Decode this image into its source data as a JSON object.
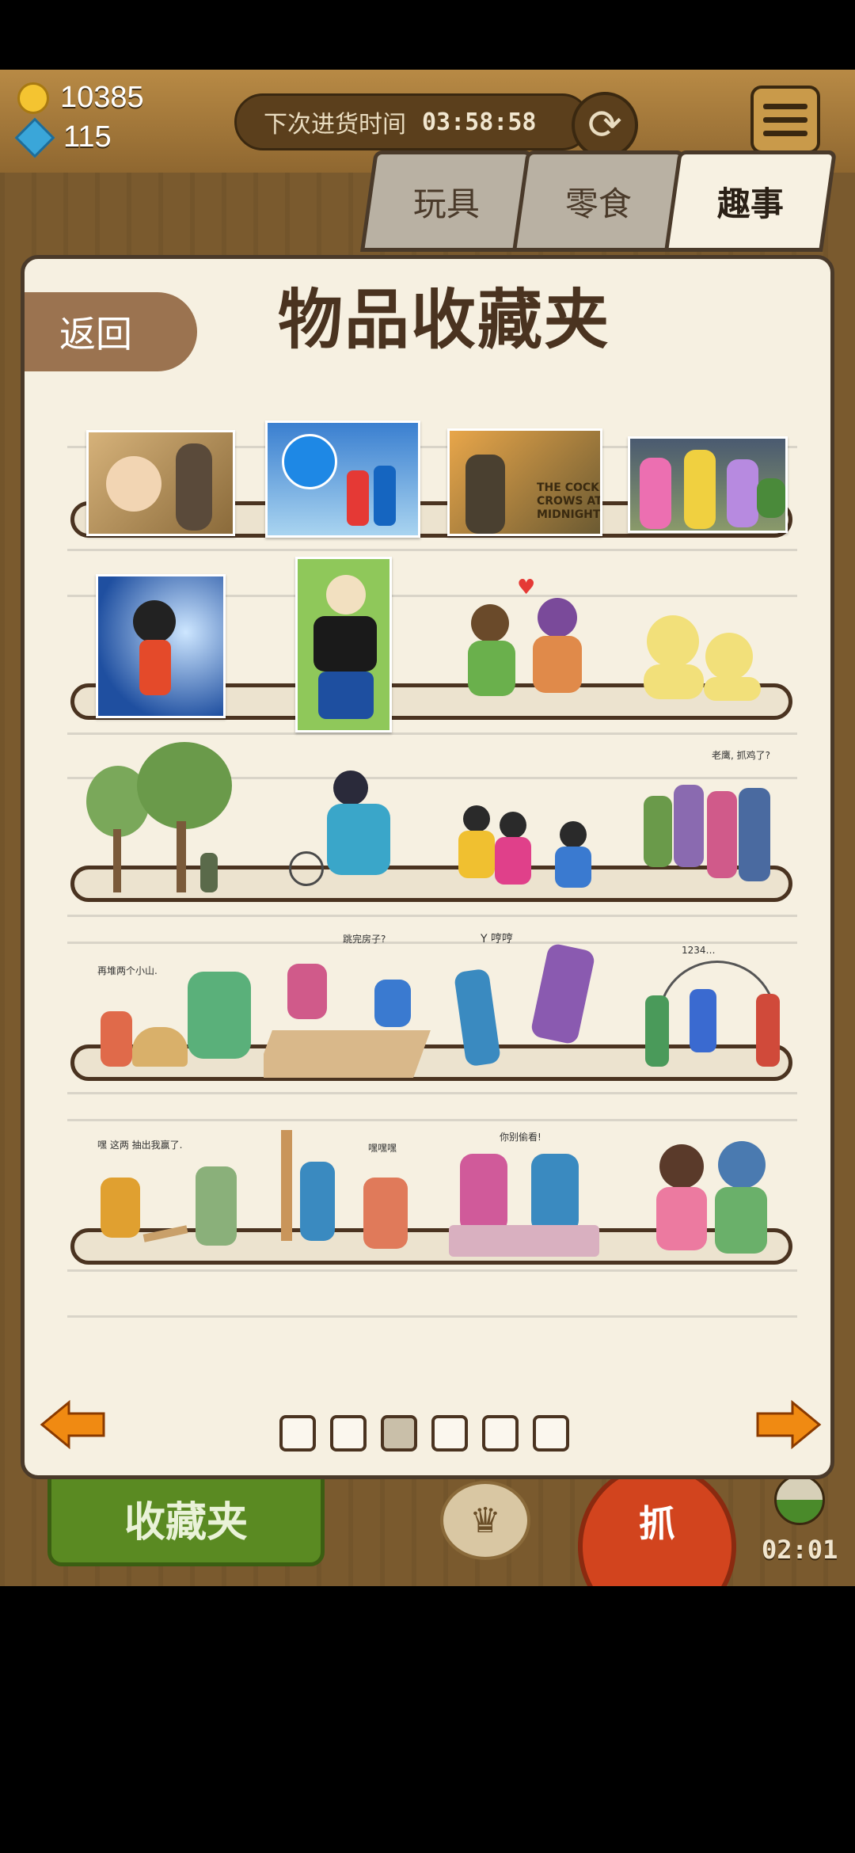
{
  "status": {
    "coins": "10385",
    "gems": "115"
  },
  "restock": {
    "label": "下次进货时间",
    "timer": "03:58:58"
  },
  "tabs": [
    {
      "label": "玩具"
    },
    {
      "label": "零食"
    },
    {
      "label": "趣事"
    }
  ],
  "active_tab": "趣事",
  "panel": {
    "title": "物品收藏夹",
    "back_label": "返回"
  },
  "items": {
    "row1": [
      "big-head-son-card",
      "doraemon-card",
      "cock-crows-card",
      "black-cat-mice-card"
    ],
    "row1_texts": {
      "cock_crows": "THE COCK CROWS AT MIDNIGHT"
    },
    "row2": [
      "astro-boy-card",
      "popeye-card",
      "kids-sharing-figure",
      "twin-sprouts-figure"
    ],
    "row3": [
      "kids-in-forest-figure",
      "rolling-hoop-figure",
      "kids-playing-figure",
      "kids-line-figure"
    ],
    "row3_texts": {
      "kids_line": "老鹰, 抓鸡了?"
    },
    "row4": [
      "sand-play-figure",
      "hopscotch-figure",
      "kick-play-figure",
      "jump-rope-figure"
    ],
    "row4_texts": {
      "sand_play": "再堆两个小山.",
      "hopscotch": "跳完房子?",
      "kick_play": "Y 哼哼",
      "jump_rope": "1234…"
    },
    "row5": [
      "sticks-game-figure",
      "hide-seek-figure",
      "homework-figure",
      "happy-pair-figure"
    ],
    "row5_texts": {
      "sticks_game": "嘿 这两 抽出我赢了.",
      "hide_seek": "嘿嘿嘿",
      "homework": "你别偷看!"
    }
  },
  "pagination": {
    "pages": 6,
    "current": 3
  },
  "bottom": {
    "collection_label": "收藏夹",
    "grab_label": "抓",
    "timer": "02:01"
  },
  "colors": {
    "panel_bg": "#f6f0e1",
    "frame_brown": "#4a3320",
    "back_button": "#9b7350",
    "arrow_orange": "#f08a12"
  }
}
